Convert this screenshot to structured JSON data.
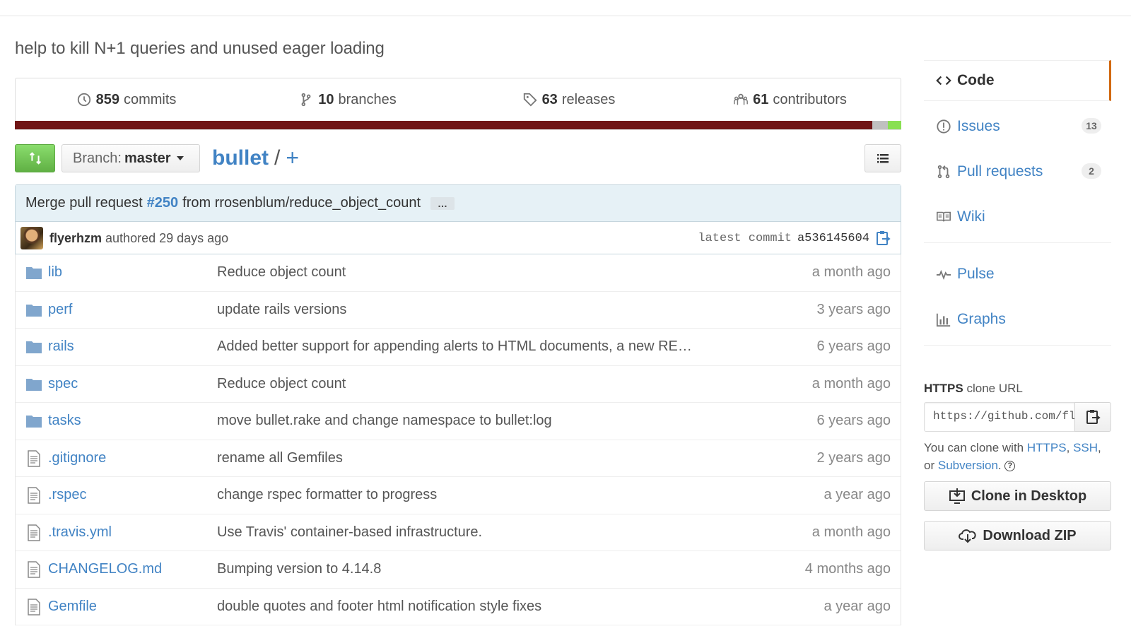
{
  "description": "help to kill N+1 queries and unused eager loading",
  "stats": {
    "commits_count": "859",
    "commits_label": "commits",
    "branches_count": "10",
    "branches_label": "branches",
    "releases_count": "63",
    "releases_label": "releases",
    "contributors_count": "61",
    "contributors_label": "contributors"
  },
  "toolbar": {
    "branch_prefix": "Branch:",
    "branch_name": "master",
    "repo_name": "bullet",
    "separator": "/",
    "plus": "+"
  },
  "commit": {
    "title_prefix": "Merge pull request",
    "pr_number": "#250",
    "title_suffix": "from rrosenblum/reduce_object_count",
    "ellipsis": "…",
    "author": "flyerhzm",
    "authored": "authored 29 days ago",
    "latest_label": "latest commit",
    "sha": "a536145604"
  },
  "files": [
    {
      "name": "lib",
      "type": "dir",
      "message": "Reduce object count",
      "age": "a month ago"
    },
    {
      "name": "perf",
      "type": "dir",
      "message": "update rails versions",
      "age": "3 years ago"
    },
    {
      "name": "rails",
      "type": "dir",
      "message": "Added better support for appending alerts to HTML documents, a new RE…",
      "age": "6 years ago"
    },
    {
      "name": "spec",
      "type": "dir",
      "message": "Reduce object count",
      "age": "a month ago"
    },
    {
      "name": "tasks",
      "type": "dir",
      "message": "move bullet.rake and change namespace to bullet:log",
      "age": "6 years ago"
    },
    {
      "name": ".gitignore",
      "type": "file",
      "message": "rename all Gemfiles",
      "age": "2 years ago"
    },
    {
      "name": ".rspec",
      "type": "file",
      "message": "change rspec formatter to progress",
      "age": "a year ago"
    },
    {
      "name": ".travis.yml",
      "type": "file",
      "message": "Use Travis' container-based infrastructure.",
      "age": "a month ago"
    },
    {
      "name": "CHANGELOG.md",
      "type": "file",
      "message": "Bumping version to 4.14.8",
      "age": "4 months ago"
    },
    {
      "name": "Gemfile",
      "type": "file",
      "message": "double quotes and footer html notification style fixes",
      "age": "a year ago"
    }
  ],
  "sidebar": {
    "code": "Code",
    "issues": "Issues",
    "issues_count": "13",
    "pulls": "Pull requests",
    "pulls_count": "2",
    "wiki": "Wiki",
    "pulse": "Pulse",
    "graphs": "Graphs"
  },
  "clone": {
    "label_strong": "HTTPS",
    "label_rest": "clone URL",
    "url": "https://github.com/flyerhzm/bullet.git",
    "help_prefix": "You can clone with",
    "https": "HTTPS",
    "comma1": ",",
    "ssh": "SSH",
    "comma2": ",",
    "or": "or",
    "subversion": "Subversion",
    "period": ".",
    "desktop_button": "Clone in Desktop",
    "zip_button": "Download ZIP"
  },
  "colors": {
    "link": "#4183c4",
    "ruby": "#701516",
    "accent_orange": "#d26911",
    "compare_green": "#60b044"
  }
}
